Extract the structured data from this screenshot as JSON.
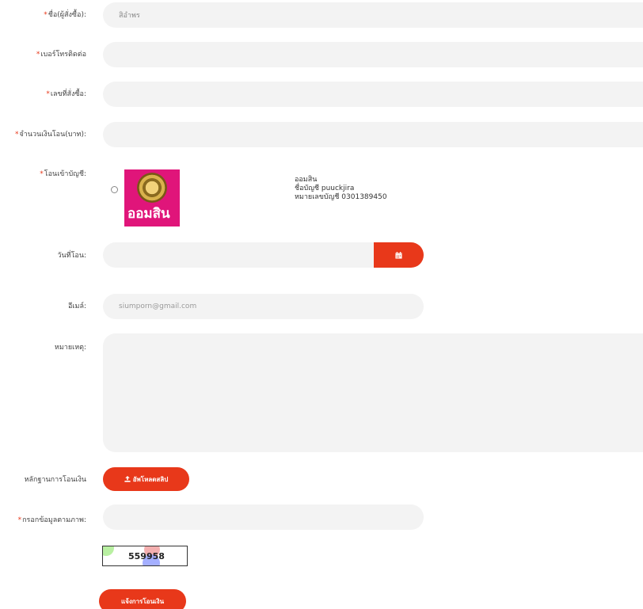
{
  "form": {
    "required_mark": "*",
    "name": {
      "label": "ชื่อ(ผู้สั่งซื้อ):",
      "value": "สิอำพร"
    },
    "phone": {
      "label": "เบอร์โทรติดต่อ",
      "value": ""
    },
    "order_no": {
      "label": "เลขที่สั่งซื้อ:",
      "value": ""
    },
    "amount": {
      "label": "จำนวนเงินโอน(บาท):",
      "value": ""
    },
    "account": {
      "label": "โอนเข้าบัญชี:",
      "logo_text": "ออมสิน",
      "bank_name": "ออมสิน",
      "account_name": "ชื่อบัญชี puuckjira",
      "account_number": "หมายเลขบัญชี 0301389450"
    },
    "transfer_date": {
      "label": "วันที่โอน:",
      "value": "",
      "icon": "calendar-icon"
    },
    "email": {
      "label": "อีเมล์:",
      "value": "siumporn@gmail.com"
    },
    "note": {
      "label": "หมายเหตุ:",
      "value": ""
    },
    "proof": {
      "label": "หลักฐานการโอนเงิน",
      "button_label": "อัพโหลดสลิป",
      "icon": "upload-icon"
    },
    "captcha": {
      "label": "กรอกข้อมูลตามภาพ:",
      "value": "",
      "code": "559958"
    },
    "submit_label": "แจ้งการโอนเงิน"
  },
  "colors": {
    "accent": "#e8381a",
    "field_bg": "#f3f3f3",
    "bank_pink": "#e0157a"
  }
}
